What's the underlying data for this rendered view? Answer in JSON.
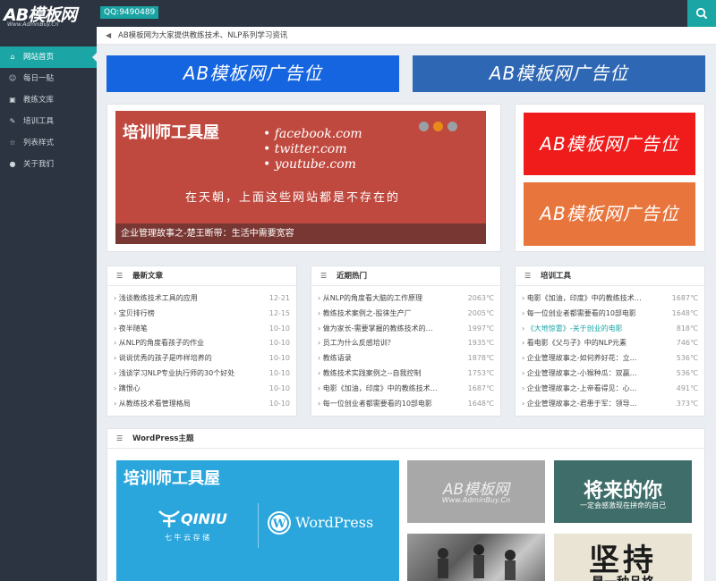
{
  "header": {
    "logo_text": "AB模板网",
    "logo_sub": "Www.AdminBuy.Cn",
    "qq": "QQ:9490489",
    "search_icon": "search-icon"
  },
  "sidebar": {
    "items": [
      {
        "label": "网站首页",
        "icon": "home-icon",
        "active": true
      },
      {
        "label": "每日一贴",
        "icon": "smile-icon"
      },
      {
        "label": "教练文库",
        "icon": "image-icon"
      },
      {
        "label": "培训工具",
        "icon": "pencil-icon"
      },
      {
        "label": "列表样式",
        "icon": "star-icon"
      },
      {
        "label": "关于我们",
        "icon": "chat-icon"
      }
    ]
  },
  "notice": {
    "icon": "megaphone-icon",
    "text": "AB模板网为大家提供教练技术、NLP系列学习资讯"
  },
  "ads": {
    "top_left": "AB模板网广告位",
    "top_right": "AB模板网广告位",
    "side_red": "AB模板网广告位",
    "side_orange": "AB模板网广告位",
    "colors": {
      "blue1": "#1565e0",
      "blue2": "#2e67b4",
      "red": "#f01c1c",
      "orange": "#e8753c"
    }
  },
  "slider": {
    "big_title": "培训师工具屋",
    "sites": [
      "facebook.com",
      "twitter.com",
      "youtube.com"
    ],
    "quote": "在天朝，上面这些网站都是不存在的",
    "caption": "企业管理故事之-楚王断带：生活中需要宽容",
    "dot_colors": [
      "#9aa0a6",
      "#e88a1a",
      "#9aa0a6"
    ]
  },
  "boxes": {
    "latest": {
      "title": "最新文章",
      "items": [
        {
          "title": "浅谈教练技术工具的应用",
          "value": "12-21"
        },
        {
          "title": "宝贝排行榜",
          "value": "12-15"
        },
        {
          "title": "夜半随笔",
          "value": "10-10"
        },
        {
          "title": "从NLP的角度看孩子的作业",
          "value": "10-10"
        },
        {
          "title": "说说优秀的孩子是咋样培养的",
          "value": "10-10"
        },
        {
          "title": "浅谈学习NLP专业执行师的30个好处",
          "value": "10-10"
        },
        {
          "title": "蹒恨心",
          "value": "10-10"
        },
        {
          "title": "从教练技术看管理格局",
          "value": "10-10"
        }
      ]
    },
    "hot": {
      "title": "近期热门",
      "items": [
        {
          "title": "从NLP的角度看大脑的工作原理",
          "value": "2063℃"
        },
        {
          "title": "教练技术案例之-股徕生产厂",
          "value": "2005℃"
        },
        {
          "title": "做为家长-需要掌握的教练技术的…",
          "value": "1997℃"
        },
        {
          "title": "员工为什么反感培训？",
          "value": "1935℃"
        },
        {
          "title": "教练语录",
          "value": "1878℃"
        },
        {
          "title": "教练技术实践案例之--自我控制",
          "value": "1753℃"
        },
        {
          "title": "电影《加油，印度》中的教练技术…",
          "value": "1687℃"
        },
        {
          "title": "每一位创业者都需要看的10部电影",
          "value": "1648℃"
        }
      ]
    },
    "tools": {
      "title": "培训工具",
      "items": [
        {
          "title": "电影《加油，印度》中的教练技术…",
          "value": "1687℃"
        },
        {
          "title": "每一位创业者都需要看的10部电影",
          "value": "1648℃"
        },
        {
          "title": "《大地惊雷》-关于创业的电影",
          "value": "818℃",
          "highlight": true
        },
        {
          "title": "看电影《父与子》中的NLP元素",
          "value": "746℃"
        },
        {
          "title": "企业管理故事之-如何养好花：立…",
          "value": "536℃"
        },
        {
          "title": "企业管理故事之-小猴种瓜：双赢…",
          "value": "536℃"
        },
        {
          "title": "企业管理故事之-上帝看得见：心…",
          "value": "491℃"
        },
        {
          "title": "企业管理故事之-君患于军：领导…",
          "value": "373℃"
        }
      ]
    }
  },
  "wordpress": {
    "title": "WordPress主题",
    "main_tile": {
      "title": "培训师工具屋",
      "qiniu": "QINIU",
      "qiniu_sub": "七 牛 云 存 储",
      "wp": "WordPress"
    },
    "tile_logo": {
      "text": "AB模板网",
      "sub": "Www.AdminBuy.Cn"
    },
    "tile_future": {
      "text": "将来的你",
      "sub": "一定会感激现在拼命的自己"
    },
    "tile_persist": {
      "text": "坚持",
      "sub": "是一种品格"
    }
  }
}
